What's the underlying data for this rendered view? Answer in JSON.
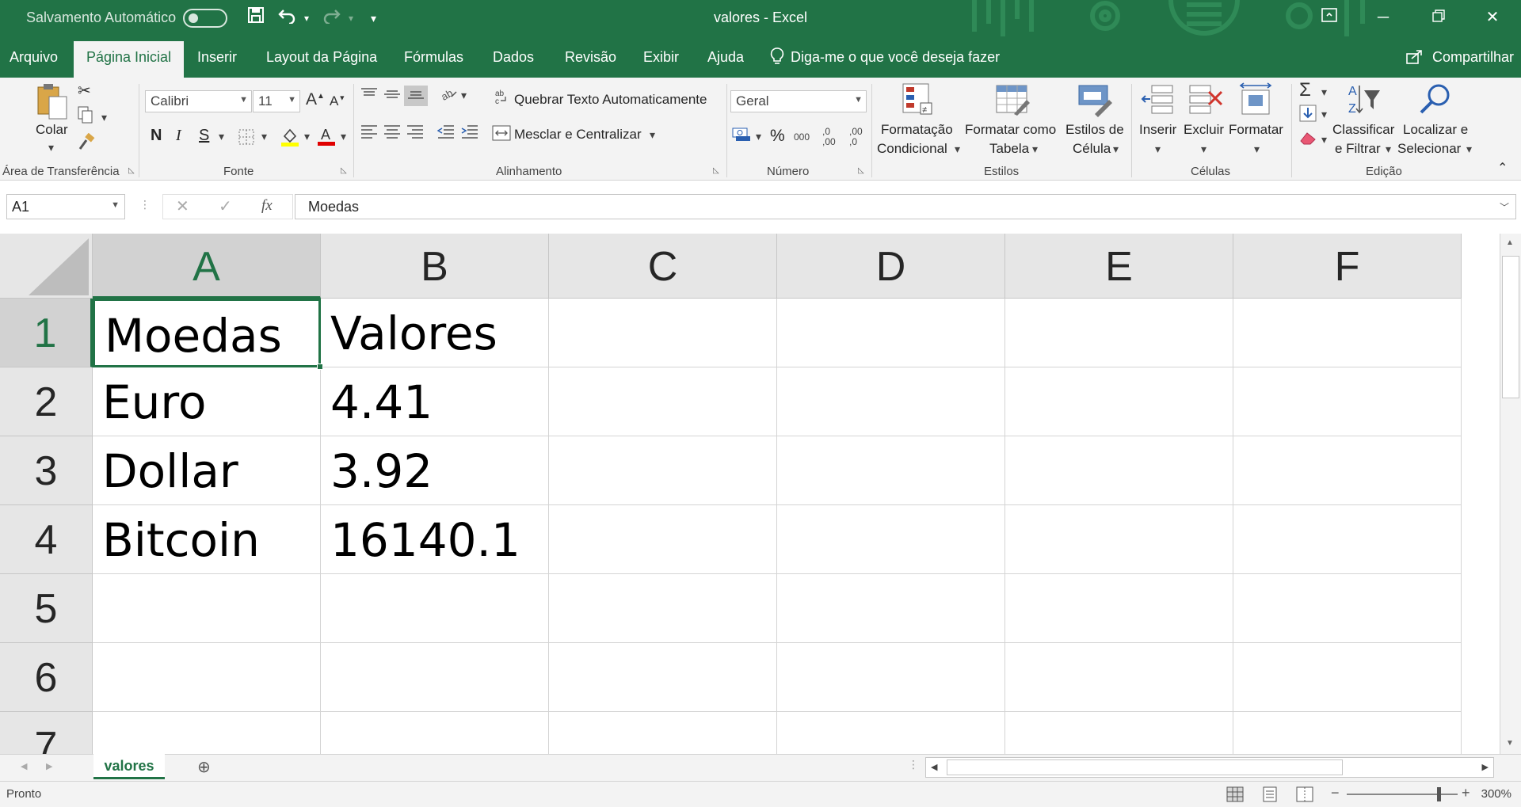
{
  "titlebar": {
    "autosave_label": "Salvamento Automático",
    "title": "valores  -  Excel"
  },
  "menu": {
    "tabs": [
      "Arquivo",
      "Página Inicial",
      "Inserir",
      "Layout da Página",
      "Fórmulas",
      "Dados",
      "Revisão",
      "Exibir",
      "Ajuda"
    ],
    "active_tab": "Página Inicial",
    "tell_me": "Diga-me o que você deseja fazer",
    "share": "Compartilhar"
  },
  "ribbon": {
    "clipboard": {
      "paste": "Colar",
      "label": "Área de Transferência"
    },
    "font": {
      "name": "Calibri",
      "size": "11",
      "bold": "N",
      "italic": "I",
      "underline": "S",
      "label": "Fonte"
    },
    "alignment": {
      "wrap": "Quebrar Texto Automaticamente",
      "merge": "Mesclar e Centralizar",
      "label": "Alinhamento"
    },
    "number": {
      "format": "Geral",
      "percent": "%",
      "thousands": "000",
      "inc_decimal": ",0 ,00",
      "dec_decimal": ",00 ,0",
      "label": "Número"
    },
    "styles": {
      "conditional_1": "Formatação",
      "conditional_2": "Condicional",
      "table_1": "Formatar como",
      "table_2": "Tabela",
      "cell_1": "Estilos de",
      "cell_2": "Célula",
      "label": "Estilos"
    },
    "cells": {
      "insert": "Inserir",
      "delete": "Excluir",
      "format": "Formatar",
      "label": "Células"
    },
    "editing": {
      "sort_1": "Classificar",
      "sort_2": "e Filtrar",
      "find_1": "Localizar e",
      "find_2": "Selecionar",
      "label": "Edição"
    }
  },
  "formula_bar": {
    "name_box": "A1",
    "fx": "fx",
    "content": "Moedas"
  },
  "grid": {
    "columns": [
      "A",
      "B",
      "C",
      "D",
      "E",
      "F"
    ],
    "selected_column": "A",
    "rows": [
      "1",
      "2",
      "3",
      "4",
      "5",
      "6",
      "7"
    ],
    "selected_row": "1",
    "cells": [
      [
        "Moedas",
        "Valores"
      ],
      [
        "Euro",
        "4.41"
      ],
      [
        "Dollar",
        "3.92"
      ],
      [
        "Bitcoin",
        "16140.1"
      ]
    ]
  },
  "sheets": {
    "tabs": [
      "valores"
    ],
    "active": "valores"
  },
  "status": {
    "text": "Pronto",
    "zoom": "300%"
  },
  "colors": {
    "brand": "#217346",
    "ribbon_bg": "#f3f3f3",
    "header_bg": "#e6e6e6"
  }
}
